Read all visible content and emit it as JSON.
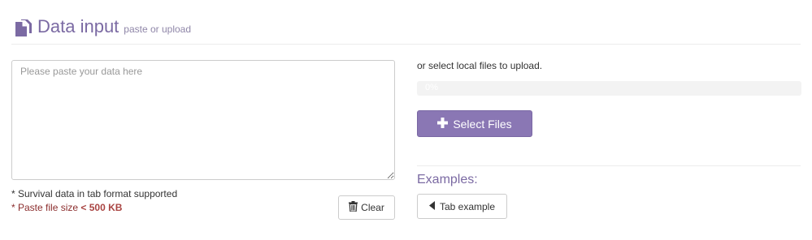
{
  "header": {
    "icon": "documents-icon",
    "title": "Data input",
    "subtitle": "paste or upload"
  },
  "paste": {
    "placeholder": "Please paste your data here",
    "value": ""
  },
  "notes": {
    "format": "* Survival data in tab format supported",
    "size_prefix": "* Paste file size",
    "size_limit": "< 500 KB"
  },
  "clear_button": {
    "icon": "trash-icon",
    "label": "Clear"
  },
  "upload": {
    "label": "or select local files to upload.",
    "progress_percent": 0,
    "progress_text": "0%",
    "select_button_icon": "plus-icon",
    "select_button_label": "Select Files"
  },
  "examples": {
    "label": "Examples:",
    "tab_button_icon": "caret-left-icon",
    "tab_button_label": "Tab example"
  },
  "colors": {
    "accent": "#7b6aa3",
    "button_purple": "#8a77b4",
    "limit_red": "#a94442"
  }
}
